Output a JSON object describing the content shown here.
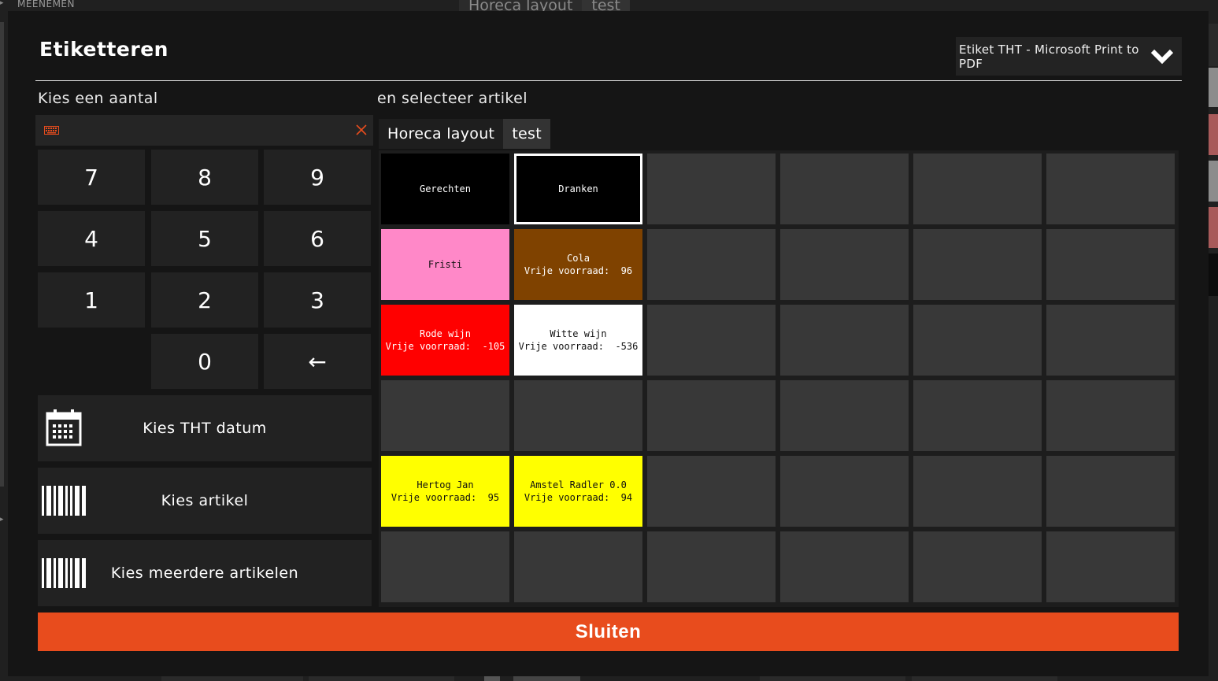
{
  "background": {
    "top_label": "MEENEMEN",
    "top_tabs": [
      "Horeca layout",
      "test"
    ]
  },
  "modal": {
    "title": "Etiketteren",
    "printer": {
      "selected": "Etiket THT - Microsoft Print to PDF",
      "icon": "chevron-down-icon"
    },
    "quantity_section": {
      "label": "Kies een aantal",
      "input_value": "",
      "keyboard_icon": "keyboard-icon",
      "clear_icon": "close-icon",
      "accent_color": "#e84c1d"
    },
    "keypad": {
      "keys": [
        "7",
        "8",
        "9",
        "4",
        "5",
        "6",
        "1",
        "2",
        "3",
        "0",
        "←"
      ]
    },
    "actions": {
      "tht_date": {
        "label": "Kies THT datum",
        "icon": "calendar-icon"
      },
      "article": {
        "label": "Kies artikel",
        "icon": "barcode-icon"
      },
      "multiple_articles": {
        "label": "Kies meerdere artikelen",
        "icon": "barcode-icon"
      }
    },
    "article_section": {
      "label": "en selecteer artikel",
      "tabs": [
        {
          "label": "Horeca layout",
          "active": false
        },
        {
          "label": "test",
          "active": true
        }
      ]
    },
    "tiles": [
      {
        "row": 0,
        "col": 0,
        "line1": "Gerechten",
        "line2": "",
        "bg": "#000000",
        "fg": "#ffffff",
        "selected": false
      },
      {
        "row": 0,
        "col": 1,
        "line1": "Dranken",
        "line2": "",
        "bg": "#000000",
        "fg": "#ffffff",
        "selected": true
      },
      {
        "row": 1,
        "col": 0,
        "line1": "Fristi",
        "line2": "",
        "bg": "#ff88c8",
        "fg": "#111111",
        "selected": false
      },
      {
        "row": 1,
        "col": 1,
        "line1": "Cola",
        "line2": "Vrije voorraad:  96",
        "bg": "#7f4200",
        "fg": "#ffffff",
        "selected": false
      },
      {
        "row": 2,
        "col": 0,
        "line1": "Rode wijn",
        "line2": "Vrije voorraad:  -105",
        "bg": "#ff0000",
        "fg": "#ffffff",
        "selected": false
      },
      {
        "row": 2,
        "col": 1,
        "line1": "Witte wijn",
        "line2": "Vrije voorraad:  -536",
        "bg": "#ffffff",
        "fg": "#111111",
        "selected": false
      },
      {
        "row": 4,
        "col": 0,
        "line1": "Hertog Jan",
        "line2": "Vrije voorraad:  95",
        "bg": "#ffff00",
        "fg": "#111111",
        "selected": false
      },
      {
        "row": 4,
        "col": 1,
        "line1": "Amstel Radler 0.0",
        "line2": "Vrije voorraad:  94",
        "bg": "#ffff00",
        "fg": "#111111",
        "selected": false
      }
    ],
    "empty_tile_color": "#383838",
    "close_button": {
      "label": "Sluiten",
      "color": "#e84c1d"
    }
  }
}
